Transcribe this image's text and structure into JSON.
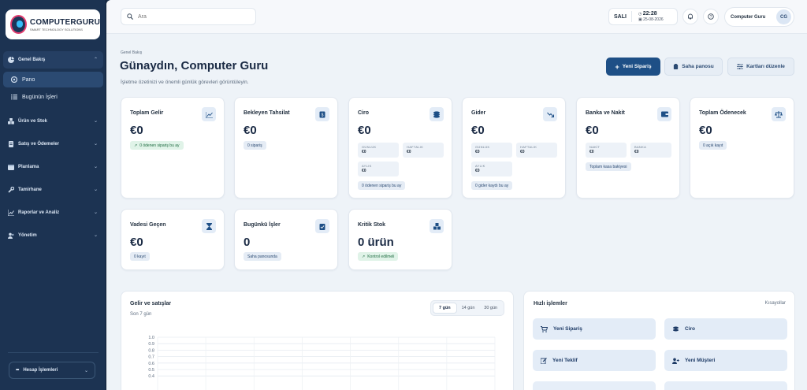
{
  "brand": {
    "name": "COMPUTERGURU",
    "tagline": "SMART TECHNOLOGY SOLUTIONS"
  },
  "sidebar": {
    "items": [
      {
        "label": "Genel Bakış",
        "icon": "pie-icon",
        "expanded": true
      },
      {
        "label": "Ürün ve Stok",
        "icon": "boxes-icon"
      },
      {
        "label": "Satış ve Ödemeler",
        "icon": "receipt-icon"
      },
      {
        "label": "Planlama",
        "icon": "calendar-icon"
      },
      {
        "label": "Tamirhane",
        "icon": "wrench-icon"
      },
      {
        "label": "Raporlar ve Analiz",
        "icon": "chart-icon"
      },
      {
        "label": "Yönetim",
        "icon": "users-icon"
      }
    ],
    "sub_items": [
      {
        "label": "Pano",
        "active": true
      },
      {
        "label": "Bugünün İşleri"
      }
    ],
    "account_label": "Hesap İşlemleri"
  },
  "topbar": {
    "search_placeholder": "Ara",
    "day": "SALI",
    "time": "22:28",
    "date": "25-08-2026",
    "user_name": "Computer Guru",
    "user_initials": "CG"
  },
  "page": {
    "breadcrumb": "Genel Bakış",
    "greeting": "Günaydın, Computer Guru",
    "description": "İşletme özetinizi ve önemli günlük görevleri görüntüleyin.",
    "actions": {
      "new_order": "Yeni Sipariş",
      "field_panel": "Saha panosu",
      "edit_cards": "Kartları düzenle"
    }
  },
  "cards": {
    "gelir": {
      "title": "Toplam Gelir",
      "value": "€0",
      "pill": "0 ödenen sipariş bu ay"
    },
    "tahsilat": {
      "title": "Bekleyen Tahsilat",
      "value": "€0",
      "pill": "0 sipariş"
    },
    "ciro": {
      "title": "Ciro",
      "value": "€0",
      "daily_label": "GÜNLÜK",
      "daily": "€0",
      "weekly_label": "HAFTALIK",
      "weekly": "€0",
      "monthly_label": "AYLIK",
      "monthly": "€0",
      "pill": "0 ödenen sipariş bu ay"
    },
    "gider": {
      "title": "Gider",
      "value": "€0",
      "daily_label": "GÜNLÜK",
      "daily": "€0",
      "weekly_label": "HAFTALIK",
      "weekly": "€0",
      "monthly_label": "AYLIK",
      "monthly": "€0",
      "pill": "0 gider kaydı bu ay"
    },
    "banka": {
      "title": "Banka ve Nakit",
      "value": "€0",
      "cash_label": "NAKİT",
      "cash": "€0",
      "bank_label": "BANKA",
      "bank": "€0",
      "pill": "Toplam kasa bakiyesi"
    },
    "odenecek": {
      "title": "Toplam Ödenecek",
      "value": "€0",
      "pill": "0 açık kayıt"
    },
    "vadesi": {
      "title": "Vadesi Geçen",
      "value": "€0",
      "pill": "0 kayıt"
    },
    "isler": {
      "title": "Bugünkü İşler",
      "value": "0",
      "pill": "Saha panosunda"
    },
    "stok": {
      "title": "Kritik Stok",
      "value": "0 ürün",
      "pill": "Kontrol edilmeli"
    }
  },
  "sales_chart": {
    "title": "Gelir ve satışlar",
    "subtitle": "Son 7 gün",
    "ranges": [
      "7 gün",
      "14 gün",
      "30 gün"
    ],
    "active_range": "7 gün"
  },
  "chart_data": {
    "type": "line",
    "title": "Gelir ve satışlar",
    "subtitle": "Son 7 gün",
    "yticks": [
      "1.0",
      "0.9",
      "0.8",
      "0.7",
      "0.6",
      "0.5",
      "0.4"
    ],
    "ylim": [
      0,
      1.0
    ],
    "grid": true,
    "series": []
  },
  "quick": {
    "title": "Hızlı işlemler",
    "shortcuts_label": "Kısayollar",
    "buttons": [
      {
        "label": "Yeni Sipariş",
        "icon": "cart-icon"
      },
      {
        "label": "Ciro",
        "icon": "coins-icon"
      },
      {
        "label": "Yeni Teklif",
        "icon": "edit-icon"
      },
      {
        "label": "Yeni Müşteri",
        "icon": "user-plus-icon"
      }
    ]
  }
}
